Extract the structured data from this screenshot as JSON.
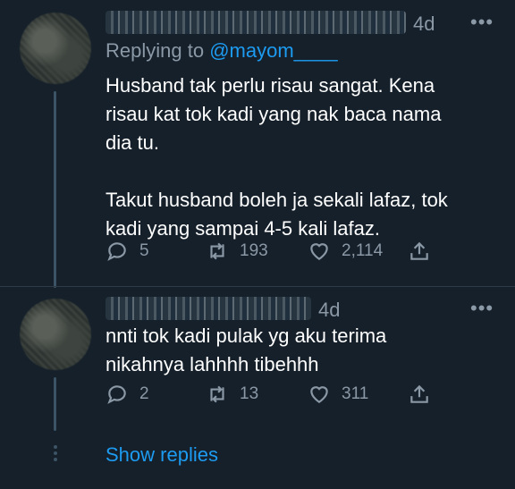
{
  "tweets": [
    {
      "time": "4d",
      "reply_prefix": "Replying to ",
      "reply_handle": "@mayom____",
      "text": "Husband tak perlu risau sangat. Kena\nrisau kat tok kadi yang nak baca nama\ndia tu.\n\nTakut husband boleh ja sekali lafaz, tok\nkadi yang sampai 4-5 kali lafaz.",
      "replies": "5",
      "retweets": "193",
      "likes": "2,114"
    },
    {
      "time": "4d",
      "text": "nnti tok kadi pulak yg aku terima\nnikahnya lahhhh tibehhh",
      "replies": "2",
      "retweets": "13",
      "likes": "311"
    }
  ],
  "more_icon": "•••",
  "show_replies": "Show replies",
  "colors": {
    "background": "#15202b",
    "accent": "#1d9bf0",
    "muted": "#8b98a5"
  }
}
